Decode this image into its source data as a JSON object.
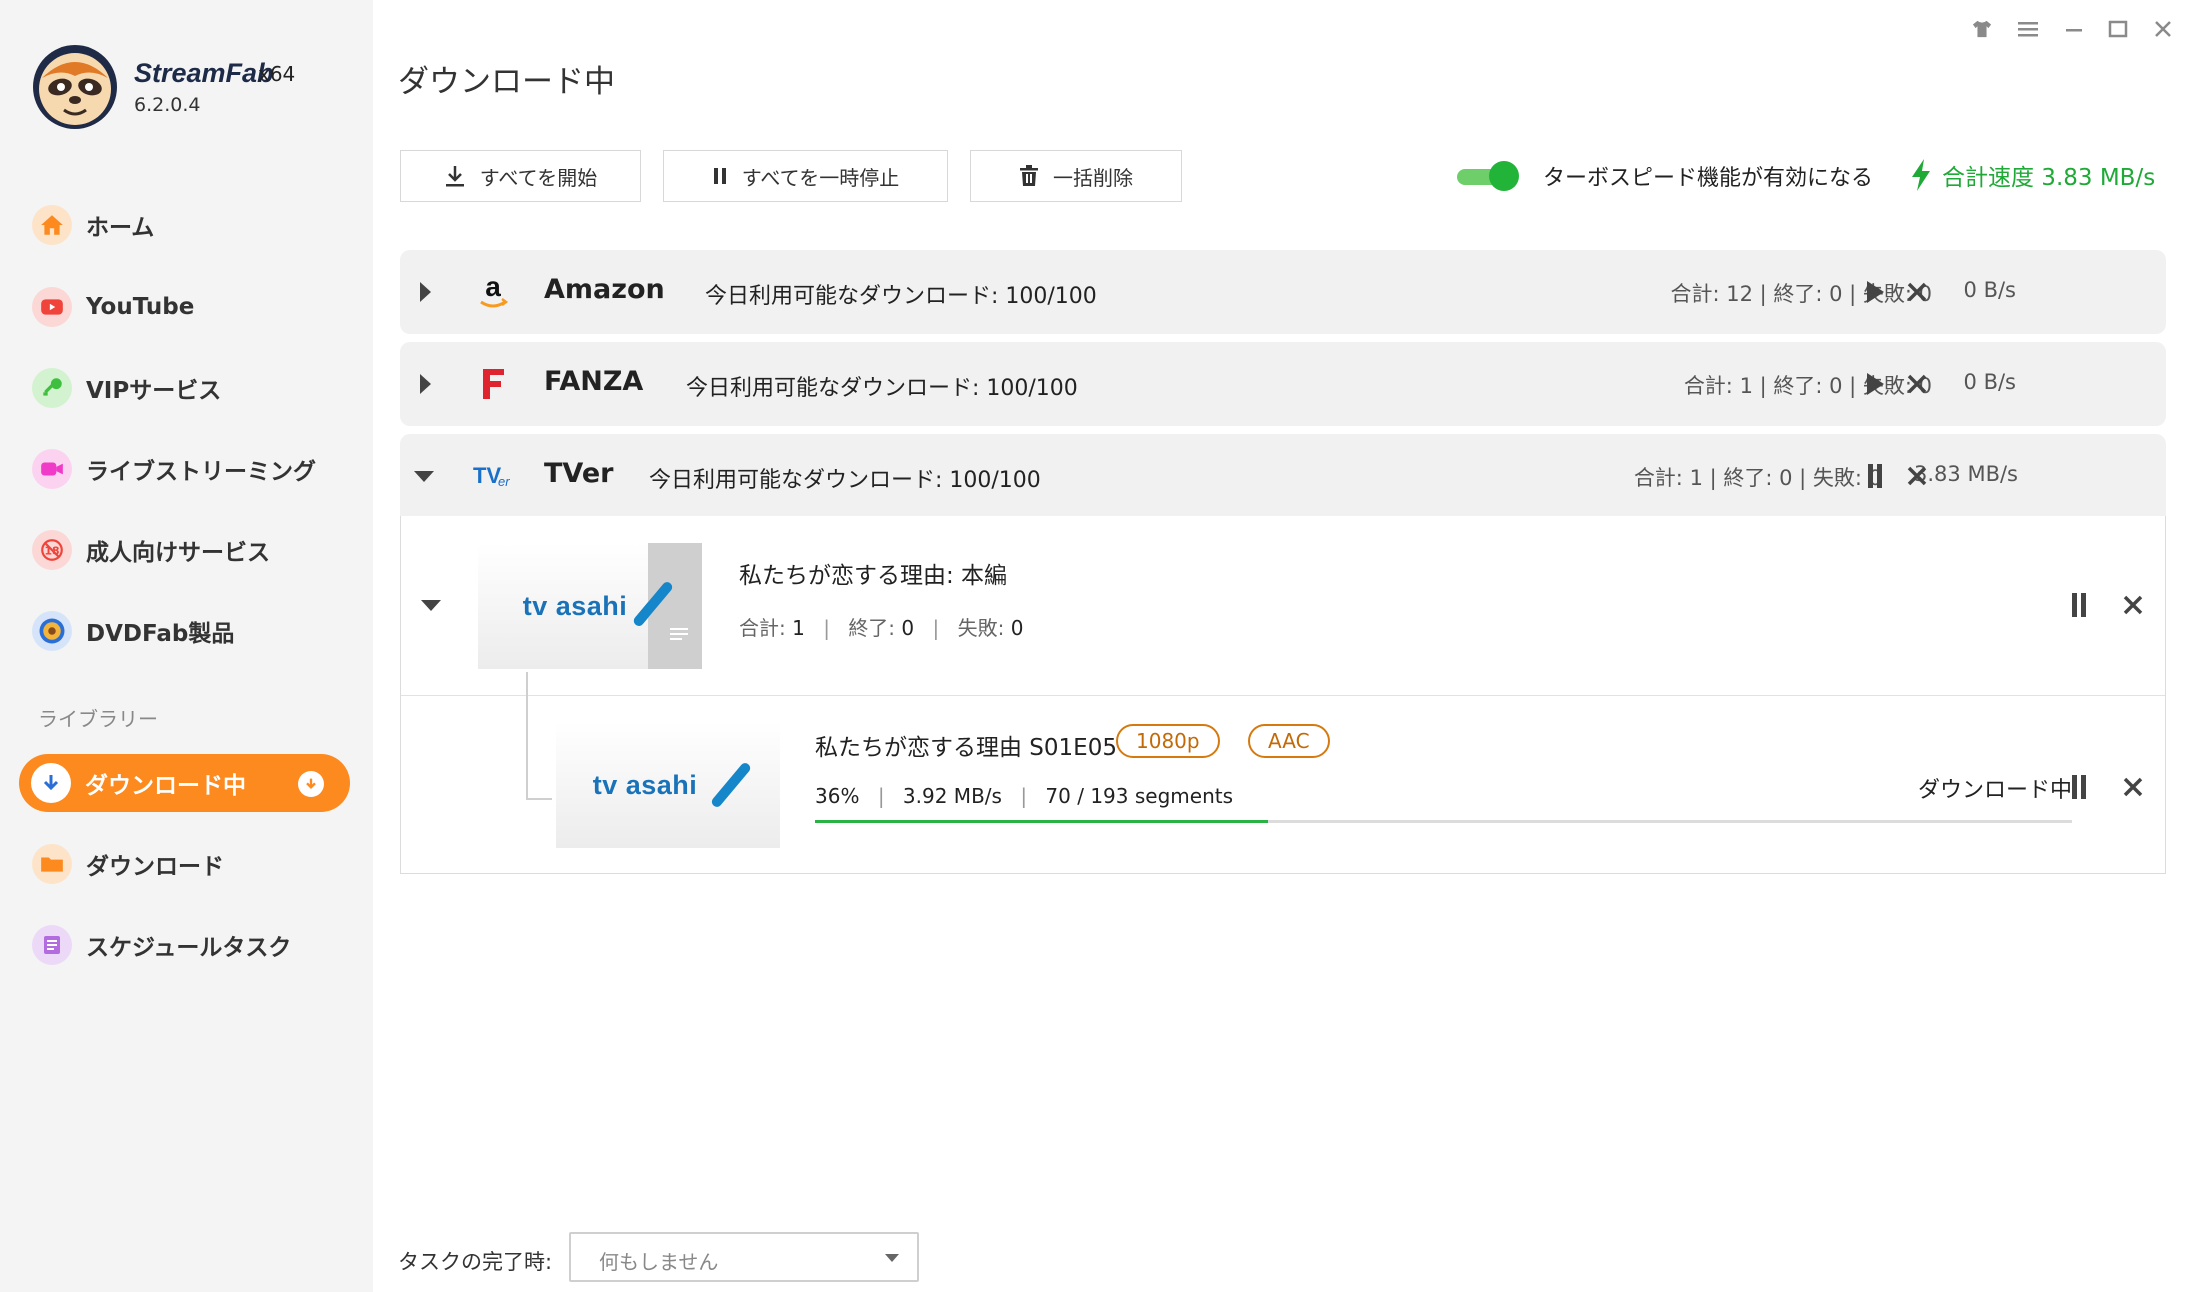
{
  "app": {
    "brand": "StreamFab",
    "arch": "x64",
    "version": "6.2.0.4"
  },
  "sidebar": {
    "items": [
      {
        "label": "ホーム",
        "icon": "home-icon",
        "color": "#fc8a1f"
      },
      {
        "label": "YouTube",
        "icon": "youtube-icon",
        "color": "#f0433a"
      },
      {
        "label": "VIPサービス",
        "icon": "key-icon",
        "color": "#3fbf3f"
      },
      {
        "label": "ライブストリーミング",
        "icon": "video-camera-icon",
        "color": "#f03ac8"
      },
      {
        "label": "成人向けサービス",
        "icon": "adult-18-icon",
        "color": "#f0433a"
      },
      {
        "label": "DVDFab製品",
        "icon": "dvdfab-icon",
        "color": "#2b6fd6"
      }
    ],
    "library_title": "ライブラリー",
    "library": [
      {
        "label": "ダウンロード中",
        "icon": "download-arrow-icon",
        "active": true
      },
      {
        "label": "ダウンロード",
        "icon": "folder-icon",
        "color": "#fc8a1f"
      },
      {
        "label": "スケジュールタスク",
        "icon": "schedule-list-icon",
        "color": "#b36be0"
      }
    ]
  },
  "header": {
    "title": "ダウンロード中"
  },
  "toolbar": {
    "start_all": "すべてを開始",
    "pause_all": "すべてを一時停止",
    "delete_all": "一括削除",
    "turbo_label": "ターボスピード機能が有効になる",
    "turbo_enabled": true,
    "total_speed": "合計速度 3.83 MB/s"
  },
  "groups": [
    {
      "name": "Amazon",
      "quota": "今日利用可能なダウンロード: 100/100",
      "stats": "合計: 12 | 終了: 0 | 失敗: 0",
      "rate": "0 B/s",
      "state": "paused"
    },
    {
      "name": "FANZA",
      "quota": "今日利用可能なダウンロード: 100/100",
      "stats": "合計: 1 | 終了: 0 | 失敗: 0",
      "rate": "0 B/s",
      "state": "paused"
    },
    {
      "name": "TVer",
      "quota": "今日利用可能なダウンロード: 100/100",
      "stats": "合計: 1 | 終了: 0 | 失敗: 0",
      "rate": "3.83 MB/s",
      "state": "downloading"
    }
  ],
  "task": {
    "thumb_text": "tv asahi",
    "title": "私たちが恋する理由: 本編",
    "total": "合計: ",
    "total_val": "1",
    "done": "終了: ",
    "done_val": "0",
    "fail": "失敗: ",
    "fail_val": "0",
    "episode": {
      "title": "私たちが恋する理由 S01E05",
      "quality": "1080p",
      "audio": "AAC",
      "percent": "36%",
      "speed": "3.92 MB/s",
      "segments": "70 / 193 segments",
      "progress": 0.36,
      "status": "ダウンロード中"
    }
  },
  "footer": {
    "label": "タスクの完了時:",
    "select_value": "何もしません"
  }
}
